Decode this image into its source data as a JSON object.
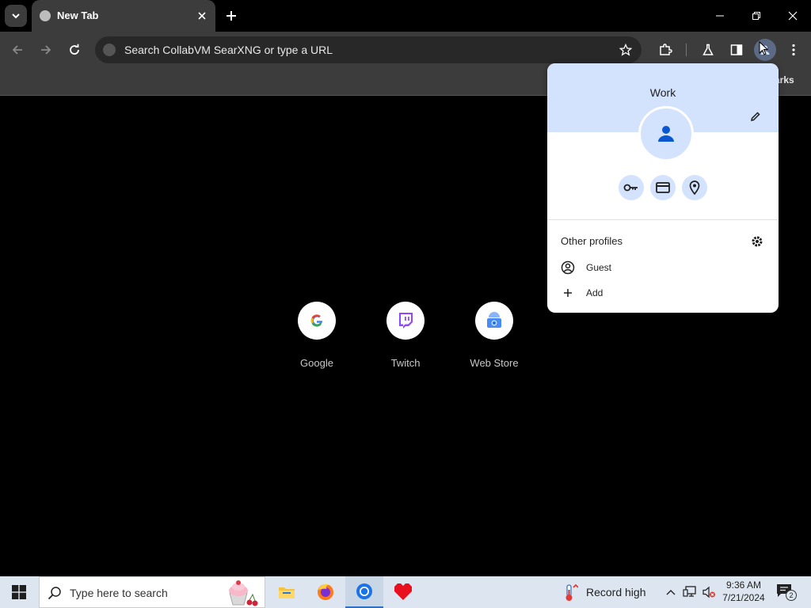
{
  "tab": {
    "title": "New Tab",
    "close_icon": "close-icon"
  },
  "omnibox": {
    "placeholder": "Search CollabVM SearXNG or type a URL"
  },
  "bookmarks": {
    "partial_text": "arks"
  },
  "shortcuts": [
    {
      "label": "Google"
    },
    {
      "label": "Twitch"
    },
    {
      "label": "Web Store"
    }
  ],
  "profile_popup": {
    "name": "Work",
    "other_profiles_label": "Other profiles",
    "guest_label": "Guest",
    "add_label": "Add"
  },
  "taskbar": {
    "search_placeholder": "Type here to search",
    "weather_text": "Record high",
    "time": "9:36 AM",
    "date": "7/21/2024",
    "notification_count": "2"
  },
  "colors": {
    "tab_bg": "#3c3c3c",
    "popup_header": "#d3e3fd",
    "icon_blue": "#0b57d0",
    "taskbar_bg": "#dde6f0"
  }
}
